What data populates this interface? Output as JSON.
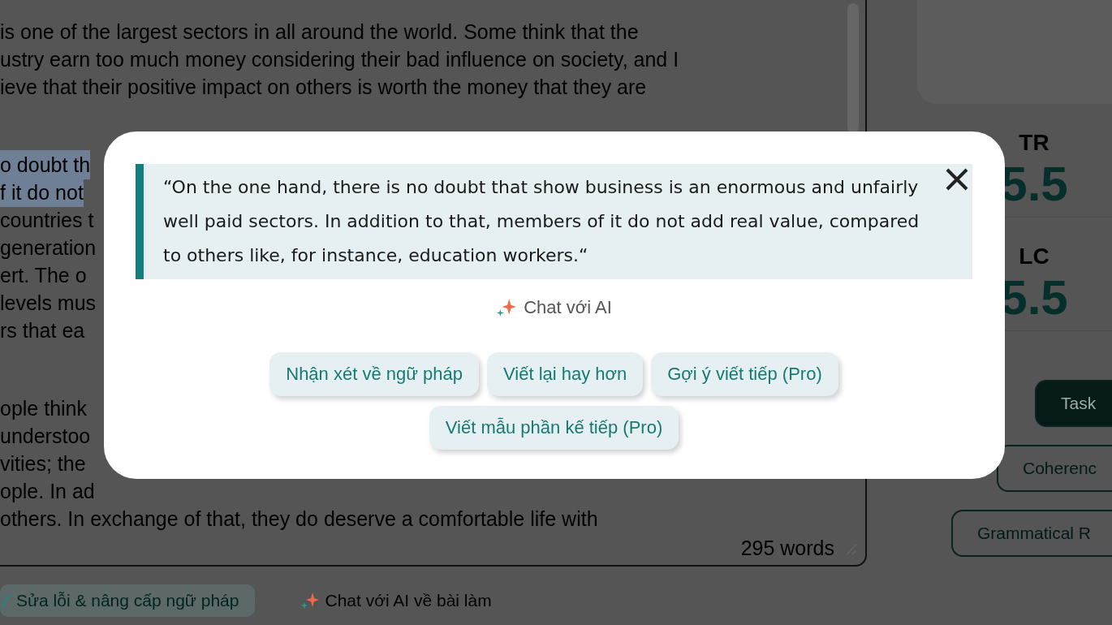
{
  "editor": {
    "paragraphs": [
      {
        "lines": [
          {
            "text": "is one of the largest sectors in all around the world. Some think that the",
            "highlighted": false
          },
          {
            "text": "ustry earn too much money considering their bad influence on society, and I",
            "highlighted": false
          },
          {
            "text": "ieve that their positive impact on others is worth the money that they are",
            "highlighted": false
          }
        ]
      },
      {
        "lines": [
          {
            "text": "o doubt th",
            "highlighted": true
          },
          {
            "text": "f it do not",
            "highlighted": true
          },
          {
            "text": "countries t",
            "highlighted": false
          },
          {
            "text": "generation",
            "highlighted": false
          },
          {
            "text": "ert. The o",
            "highlighted": false
          },
          {
            "text": "levels mus",
            "highlighted": false
          },
          {
            "text": "rs that ea",
            "highlighted": false
          }
        ]
      },
      {
        "lines": [
          {
            "text": "ople think",
            "highlighted": false
          },
          {
            "text": "understoo",
            "highlighted": false
          },
          {
            "text": "vities; the",
            "highlighted": false
          },
          {
            "text": "ople. In ad",
            "highlighted": false
          },
          {
            "text": "others. In exchange of that, they do deserve a comfortable life with",
            "highlighted": false
          }
        ]
      }
    ],
    "word_count": "295 words"
  },
  "actions": [
    {
      "label": "Sửa lỗi & nâng cấp ngữ pháp",
      "kind": "fix"
    },
    {
      "label": "Chat với AI về bài làm",
      "kind": "chat"
    }
  ],
  "scores_panel": {
    "scores": [
      {
        "label": "TR",
        "value": "5.5"
      },
      {
        "label": "LC",
        "value": "5.5"
      }
    ],
    "tabs": [
      {
        "label": "Task",
        "selected": true
      },
      {
        "label": "Coherenc",
        "selected": false
      },
      {
        "label": "Grammatical R",
        "selected": false
      }
    ]
  },
  "dialog": {
    "quote": "“On the one hand, there is no doubt that show business is an enormous and unfairly well paid sectors. In addition to that, members of it do not add real value, compared to others like, for instance, education workers.“",
    "chat_label": "Chat với AI",
    "suggestions": [
      "Nhận xét về ngữ pháp",
      "Viết lại hay hơn",
      "Gợi ý viết tiếp (Pro)",
      "Viết mẫu phần kế tiếp (Pro)"
    ]
  }
}
